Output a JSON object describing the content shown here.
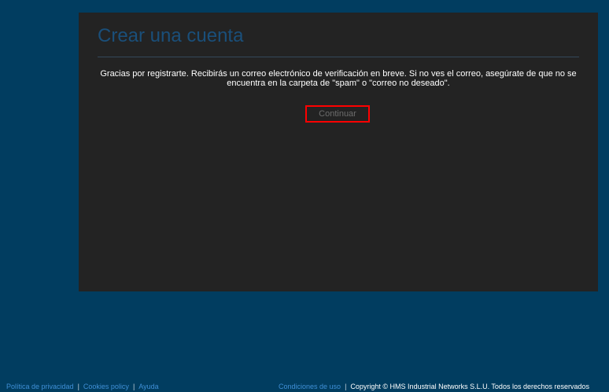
{
  "panel": {
    "title": "Crear una cuenta",
    "message": "Gracias por registrarte. Recibirás un correo electrónico de verificación en breve. Si no ves el correo, asegúrate de que no se encuentra en la carpeta de \"spam\" o \"correo no deseado\".",
    "continue_label": "Continuar"
  },
  "footer": {
    "privacy": "Política de privacidad",
    "cookies": "Cookies policy",
    "help": "Ayuda",
    "separator": "|",
    "terms": "Condiciones de uso",
    "copyright": "Copyright © HMS Industrial Networks S.L.U. Todos los derechos reservados"
  },
  "colors": {
    "page_background": "#013d60",
    "panel_background": "#232323",
    "title": "#1a4f7a",
    "link": "#3f8fd6",
    "highlight": "#ff0000"
  }
}
